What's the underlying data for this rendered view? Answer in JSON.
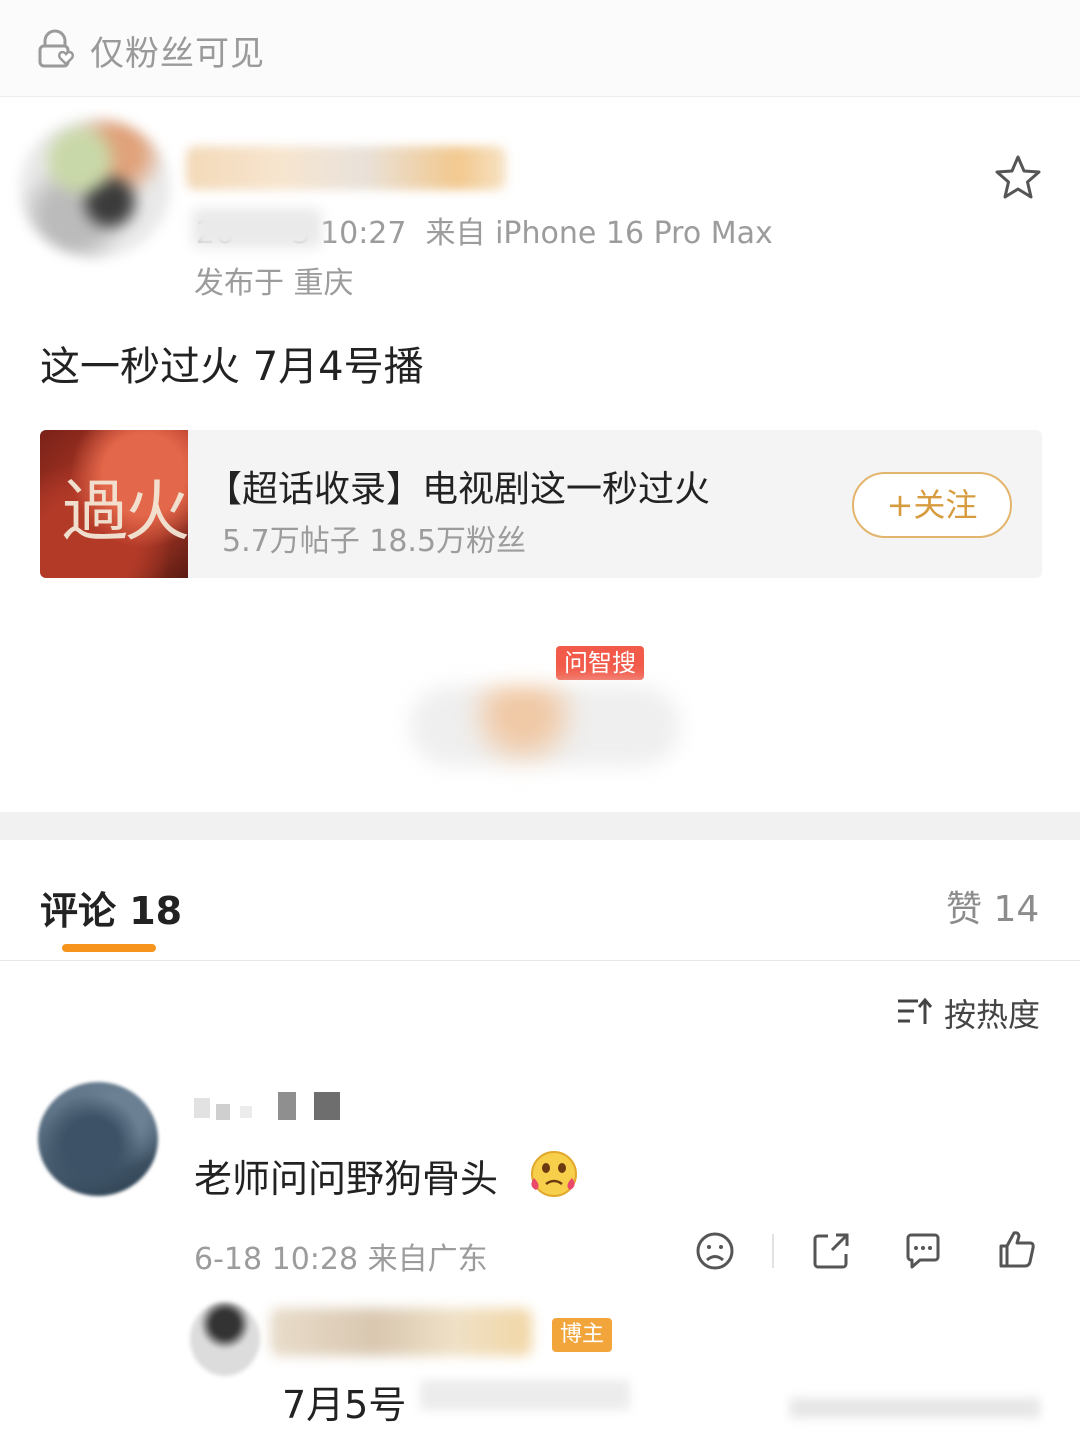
{
  "visibility": {
    "icon": "lock-heart-icon",
    "label": "仅粉丝可见"
  },
  "post": {
    "meta_line": "26      3 10:27  来自 iPhone 16 Pro Max",
    "location": "发布于 重庆",
    "text": "这一秒过火 7月4号播",
    "favorite_icon": "star-icon"
  },
  "topic_card": {
    "thumb_text": "過火",
    "title": "【超话收录】电视剧这一秒过火",
    "stats": "5.7万帖子 18.5万粉丝",
    "follow_label": "+关注"
  },
  "ai_search": {
    "badge": "问智搜"
  },
  "comments_header": {
    "comments_tab": "评论 18",
    "likes_tab": "赞 14",
    "sort_label": "按热度",
    "accent_color": "#f7941e"
  },
  "comment": {
    "text": "老师问问野狗骨头",
    "emoji": "tearful-face-emoji",
    "meta": "6-18 10:28 来自广东",
    "actions": [
      "dislike-icon",
      "share-icon",
      "reply-icon",
      "like-icon"
    ]
  },
  "reply": {
    "badge": "博主",
    "text": "7月5号"
  }
}
